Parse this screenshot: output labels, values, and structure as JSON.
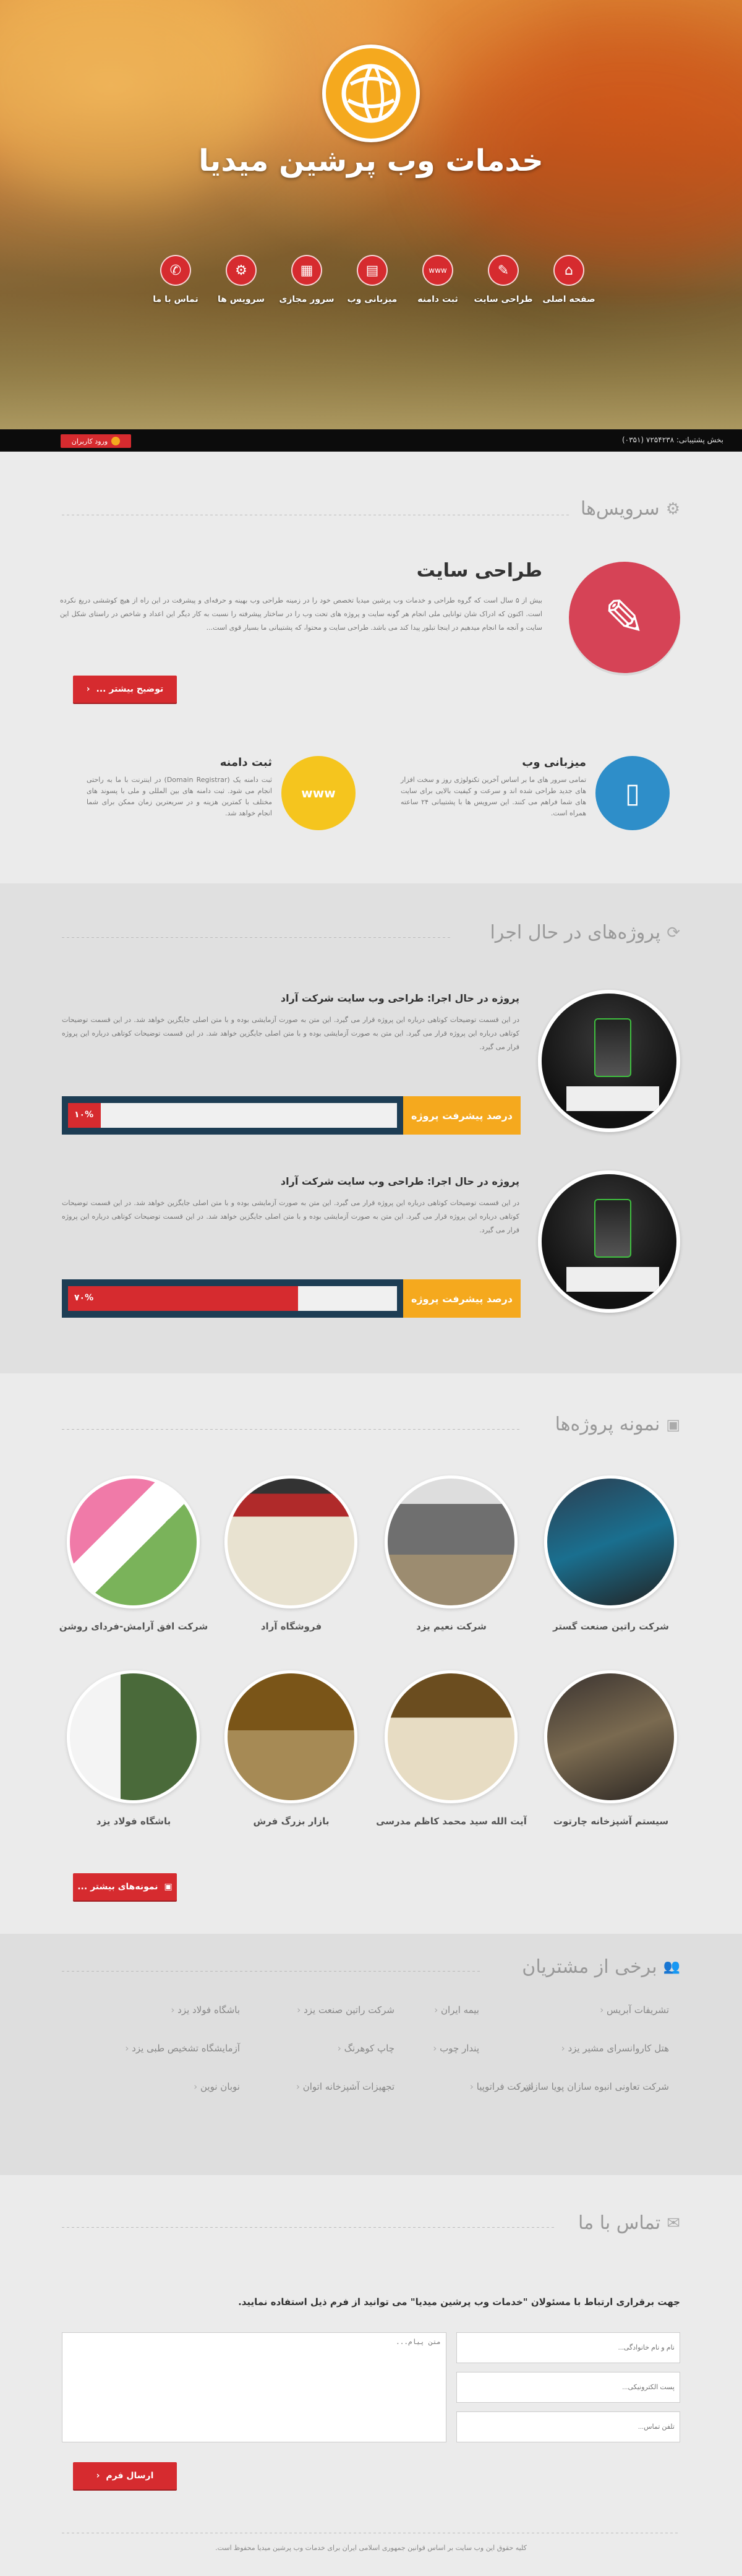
{
  "site": {
    "title": "خدمات وب پرشین میدیا"
  },
  "nav": [
    {
      "label": "صفحه اصلی",
      "icon": "home-icon"
    },
    {
      "label": "طراحی سایت",
      "icon": "pencil-icon"
    },
    {
      "label": "ثبت دامنه",
      "icon": "www-icon"
    },
    {
      "label": "میزبانی وب",
      "icon": "server-icon"
    },
    {
      "label": "سرور مجازی",
      "icon": "document-icon"
    },
    {
      "label": "سرویس ها",
      "icon": "gears-icon"
    },
    {
      "label": "تماس با ما",
      "icon": "phone-icon"
    }
  ],
  "topbar": {
    "phone": "بخش پشتیبانی: ۷۲۵۴۲۳۸ (۰۳۵۱)",
    "login": "ورود کاربران"
  },
  "services": {
    "title": "سرویس‌ها",
    "main": {
      "heading": "طراحی سایت",
      "text": "بیش از ۵ سال است که گروه طراحی و خدمات وب پرشین میدیا تخصص خود را در زمینه طراحی وب بهینه و حرفه‌ای و پیشرفت در این راه از هیچ کوششی دریغ نکرده است. اکنون که ادراک شان توانایی ملی انجام هر گونه سایت و پروژه های تحت وب را در ساختار پیشرفته را نسبت به کار دیگر این اعداد و شاخص در راستای شکل این سایت و آنجه ما انجام میدهیم در اینجا تبلور پیدا کند می باشد. طراحی سایت و محتوا، که پشتیبانی ما بسیار قوی است...",
      "button": "توضیح بیشتر ..."
    },
    "hosting": {
      "heading": "میزبانی وب",
      "text": "تمامی سرور های ما بر اساس آخرین تکنولوژی روز و سخت افزار های جدید طراحی شده اند و سرعت و کیفیت بالایی برای سایت های شما فراهم می کنند. این سرویس ها با پشتیبانی ۲۴ ساعته همراه است."
    },
    "domain": {
      "heading": "ثبت دامنه",
      "text": "ثبت دامنه یک (Domain Registrar) در اینترنت با ما به راحتی انجام می شود. ثبت دامنه های بین المللی و ملی با پسوند های مختلف با کمترین هزینه و در سریعترین زمان ممکن برای شما انجام خواهد شد."
    }
  },
  "projects": {
    "title": "پروژه‌های در حال اجرا",
    "items": [
      {
        "heading": "پروژه در حال اجرا: طراحی وب سایت شرکت آراد",
        "text": "در این قسمت توضیحات کوتاهی درباره این پروژه قرار می گیرد. این متن به صورت آزمایشی بوده و با متن اصلی جایگزین خواهد شد. در این قسمت توضیحات کوتاهی درباره این پروژه قرار می گیرد. این متن به صورت آزمایشی بوده و با متن اصلی جایگزین خواهد شد. در این قسمت توضیحات کوتاهی درباره این پروژه قرار می گیرد.",
        "progress_label": "درصد پیشرفت پروژه",
        "percent_text": "۱۰%",
        "percent": 0.1
      },
      {
        "heading": "پروژه در حال اجرا: طراحی وب سایت شرکت آراد",
        "text": "در این قسمت توضیحات کوتاهی درباره این پروژه قرار می گیرد. این متن به صورت آزمایشی بوده و با متن اصلی جایگزین خواهد شد. در این قسمت توضیحات کوتاهی درباره این پروژه قرار می گیرد. این متن به صورت آزمایشی بوده و با متن اصلی جایگزین خواهد شد. در این قسمت توضیحات کوتاهی درباره این پروژه قرار می گیرد.",
        "progress_label": "درصد پیشرفت پروژه",
        "percent_text": "۷۰%",
        "percent": 0.7
      }
    ]
  },
  "samples": {
    "title": "نمونه پروژه‌ها",
    "items": [
      "شرکت راتین صنعت گستر",
      "شرکت نعیم یزد",
      "فروشگاه آراد",
      "شرکت افق آرامش-فردای روشن",
      "سیستم آشپزخانه چارتوت",
      "آیت الله سید محمد کاظم مدرسی",
      "بازار بزرگ فرش",
      "باشگاه فولاد یزد"
    ],
    "button": "نمونه‌های بیشتر ..."
  },
  "clients": {
    "title": "برخی از مشتریان",
    "items": [
      "تشریفات آبریس",
      "بیمه ایران",
      "شرکت راتین صنعت یزد",
      "باشگاه فولاد یزد",
      "هتل کاروانسرای مشیر یزد",
      "پندار چوب",
      "چاپ کوهرنگ",
      "آزمایشگاه تشخیص طبی یزد",
      "شرکت تعاونی انبوه سازان پویا سازان",
      "شرکت فراتوپیا",
      "تجهیزات آشپزخانه اتوان",
      "نوبان نوین"
    ]
  },
  "contact": {
    "title": "تماس با ما",
    "intro": "جهت برقراری ارتباط با مسئولان \"خدمات وب پرشین میدیا\" می توانید از فرم ذیل استفاده نمایید.",
    "name_placeholder": "نام و نام خانوادگی...",
    "email_placeholder": "پست الکترونیکی...",
    "phone_placeholder": "تلفن تماس...",
    "message_placeholder": "متن پیام...",
    "submit": "ارسال فرم"
  },
  "footer": {
    "text": "کلیه حقوق این وب سایت بر اساس قوانین جمهوری اسلامی ایران برای خدمات وب پرشین میدیا محفوظ است."
  },
  "colors": {
    "accent": "#d62b2f",
    "yellow": "#f5a91e",
    "blue": "#2e8ec9",
    "navy": "#1d3d54"
  }
}
